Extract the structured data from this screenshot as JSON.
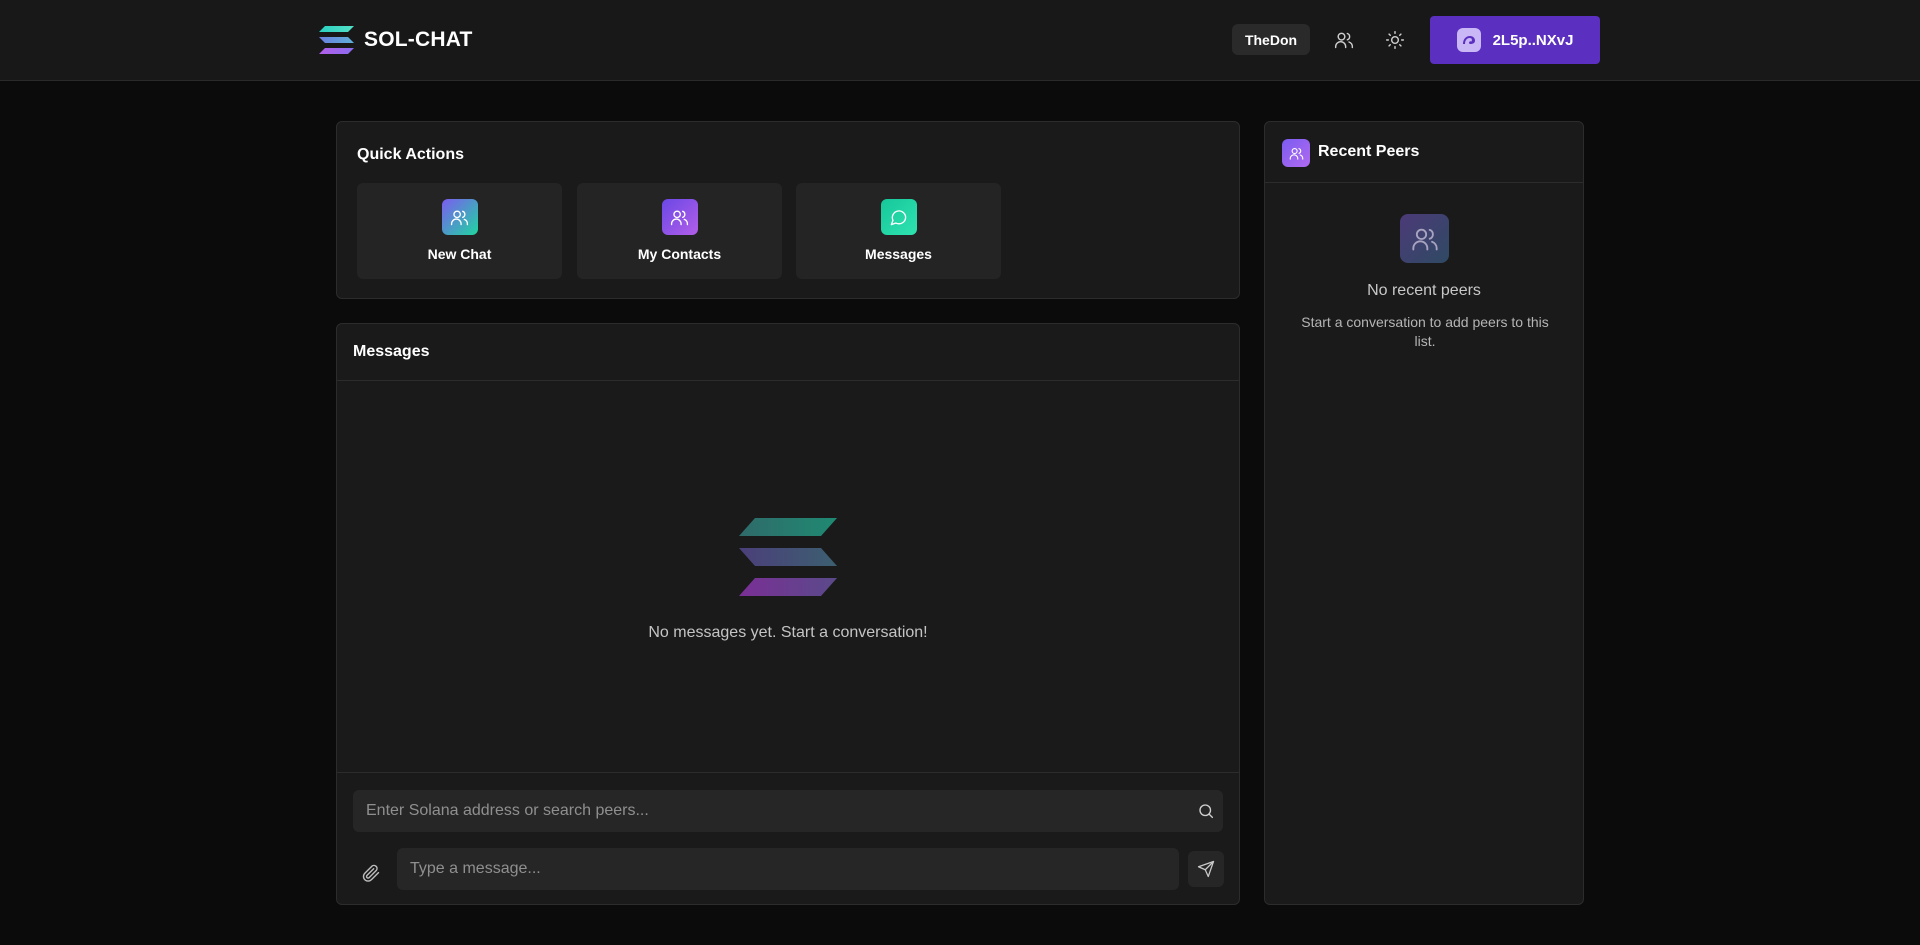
{
  "header": {
    "brand": "SOL-CHAT",
    "username": "TheDon",
    "wallet_label": "2L5p..NXvJ",
    "icons": [
      "users-icon",
      "sun-icon"
    ]
  },
  "quick_actions": {
    "title": "Quick Actions",
    "items": [
      {
        "label": "New Chat",
        "icon": "users-icon"
      },
      {
        "label": "My Contacts",
        "icon": "users-icon"
      },
      {
        "label": "Messages",
        "icon": "message-circle-icon"
      }
    ]
  },
  "messages": {
    "title": "Messages",
    "empty_text": "No messages yet. Start a conversation!",
    "search_placeholder": "Enter Solana address or search peers...",
    "message_placeholder": "Type a message..."
  },
  "recent_peers": {
    "title": "Recent Peers",
    "empty_title": "No recent peers",
    "empty_subtitle": "Start a conversation to add peers to this list."
  },
  "colors": {
    "accent": "#5b2fbf",
    "background": "#0b0b0b",
    "card": "#1a1a1a"
  }
}
